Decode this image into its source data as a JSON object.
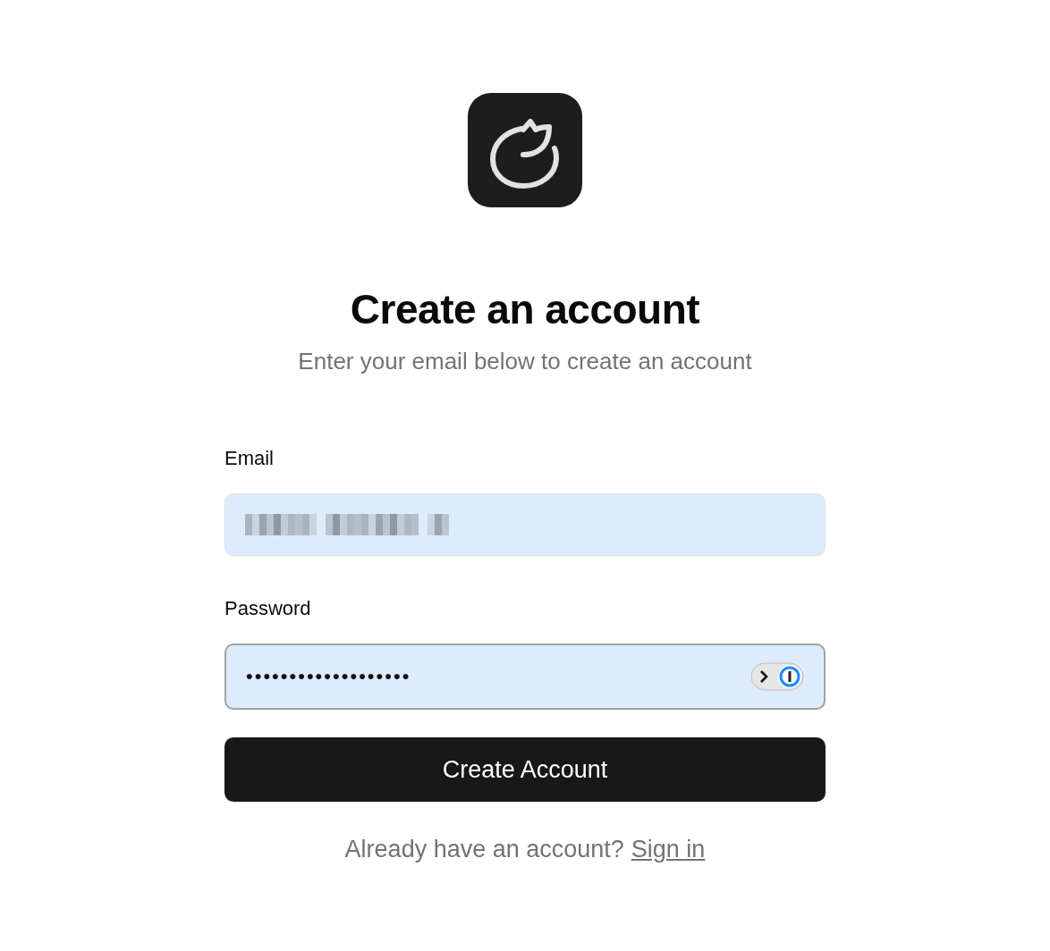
{
  "title": "Create an account",
  "subtitle": "Enter your email below to create an account",
  "fields": [
    {
      "label": "Email",
      "redacted": true,
      "focused": false,
      "autofill_button": false
    },
    {
      "label": "Password",
      "value": "•••••••••••••••••••",
      "focused": true,
      "autofill_button": true
    }
  ],
  "submit": "Create Account",
  "footer": {
    "text": "Already have an account?",
    "link": "Sign in"
  }
}
